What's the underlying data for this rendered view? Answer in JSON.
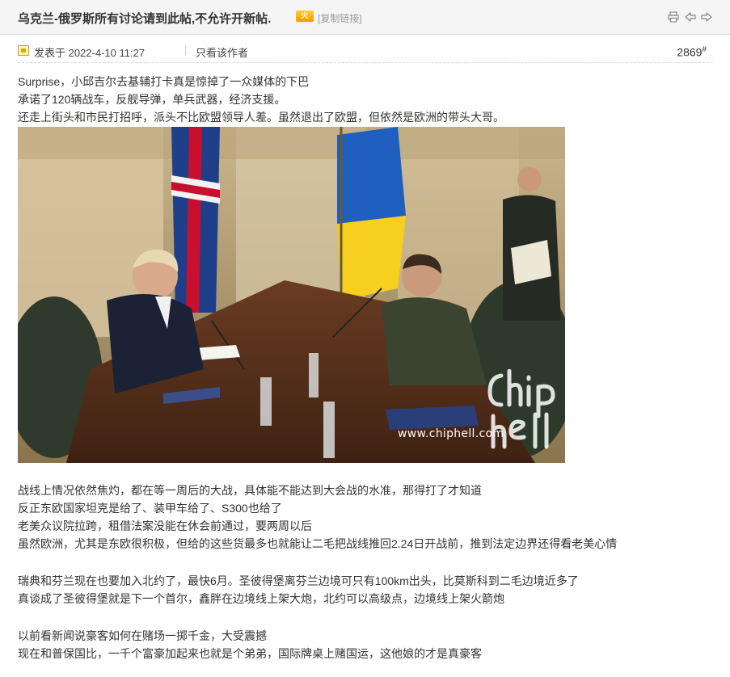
{
  "thread": {
    "title": "乌克兰-俄罗斯所有讨论请到此帖,不允许开新帖.",
    "hot_badge": "火",
    "copy_link": "[复制链接]"
  },
  "toolbar_icons": [
    "print-icon",
    "prev-thread-icon",
    "next-thread-icon"
  ],
  "post": {
    "posted_at": "发表于 2022-4-10 11:27",
    "separator": "|",
    "only_author": "只看该作者",
    "floor_number": "2869",
    "floor_mark": "#",
    "paragraphs": [
      "Surprise，小邱吉尔去基辅打卡真是惊掉了一众媒体的下巴",
      "承诺了120辆战车，反舰导弹，单兵武器，经济支援。",
      "还走上街头和市民打招呼，派头不比欧盟领导人差。虽然退出了欧盟，但依然是欧洲的带头大哥。",
      "战线上情况依然焦灼，都在等一周后的大战，具体能不能达到大会战的水准，那得打了才知道",
      "反正东欧国家坦克是给了、装甲车给了、S300也给了",
      "老美众议院拉跨，租借法案没能在休会前通过，要两周以后",
      "虽然欧洲，尤其是东欧很积极，但给的这些货最多也就能让二毛把战线推回2.24日开战前，推到法定边界还得看老美心情",
      "瑞典和芬兰现在也要加入北约了，最快6月。圣彼得堡离芬兰边境可只有100km出头，比莫斯科到二毛边境近多了",
      "真谈成了圣彼得堡就是下一个首尔，鑫胖在边境线上架大炮，北约可以高级点，边境线上架火箭炮",
      "以前看新闻说豪客如何在赌场一掷千金，大受震撼",
      "现在和普保国比，一千个富豪加起来也就是个弟弟，国际牌桌上赌国运，这他娘的才是真豪客"
    ],
    "image_watermark": "www.chiphell.com"
  },
  "colors": {
    "title_bar_bg": "#f5f5f5",
    "link_gray": "#999999",
    "text": "#333333"
  }
}
